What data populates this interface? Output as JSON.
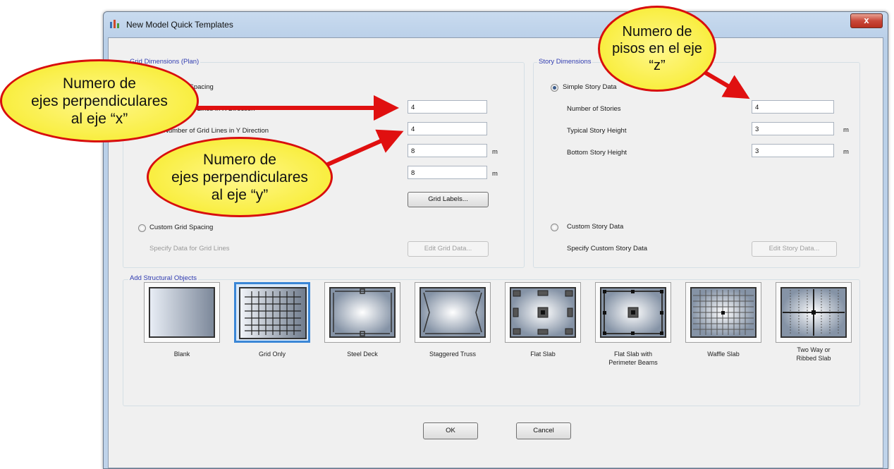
{
  "window": {
    "title": "New Model Quick Templates",
    "close_label": "x"
  },
  "grid": {
    "group_title": "Grid Dimensions (Plan)",
    "uniform_label": "Uniform Grid Spacing",
    "x_lines_label": "Number of Grid Lines in X Direction",
    "y_lines_label": "Number of Grid Lines in Y Direction",
    "x_lines_value": "4",
    "y_lines_value": "4",
    "x_spacing_value": "8",
    "y_spacing_value": "8",
    "spacing_unit": "m",
    "grid_labels_button": "Grid Labels...",
    "custom_label": "Custom Grid Spacing",
    "specify_label": "Specify Data for Grid Lines",
    "edit_grid_button": "Edit Grid Data..."
  },
  "story": {
    "group_title": "Story Dimensions",
    "simple_label": "Simple Story Data",
    "stories_label": "Number of Stories",
    "stories_value": "4",
    "typical_label": "Typical Story Height",
    "typical_value": "3",
    "bottom_label": "Bottom Story Height",
    "bottom_value": "3",
    "unit": "m",
    "custom_label": "Custom Story Data",
    "specify_label": "Specify Custom Story Data",
    "edit_story_button": "Edit Story Data..."
  },
  "objects": {
    "group_title": "Add Structural Objects",
    "items": [
      "Blank",
      "Grid Only",
      "Steel Deck",
      "Staggered Truss",
      "Flat Slab",
      "Flat Slab with\nPerimeter Beams",
      "Waffle Slab",
      "Two Way or\nRibbed Slab"
    ]
  },
  "buttons": {
    "ok": "OK",
    "cancel": "Cancel"
  },
  "annotations": {
    "x": "Numero de\nejes perpendiculares\nal eje “x”",
    "y": "Numero de\nejes perpendiculares\nal eje “y”",
    "z": "Numero de\npisos en el eje\n“z”"
  },
  "colors": {
    "bubble_fill": "#f6ea20",
    "bubble_border": "#d80e0e",
    "arrow": "#e01010",
    "selection": "#3a86d6"
  }
}
